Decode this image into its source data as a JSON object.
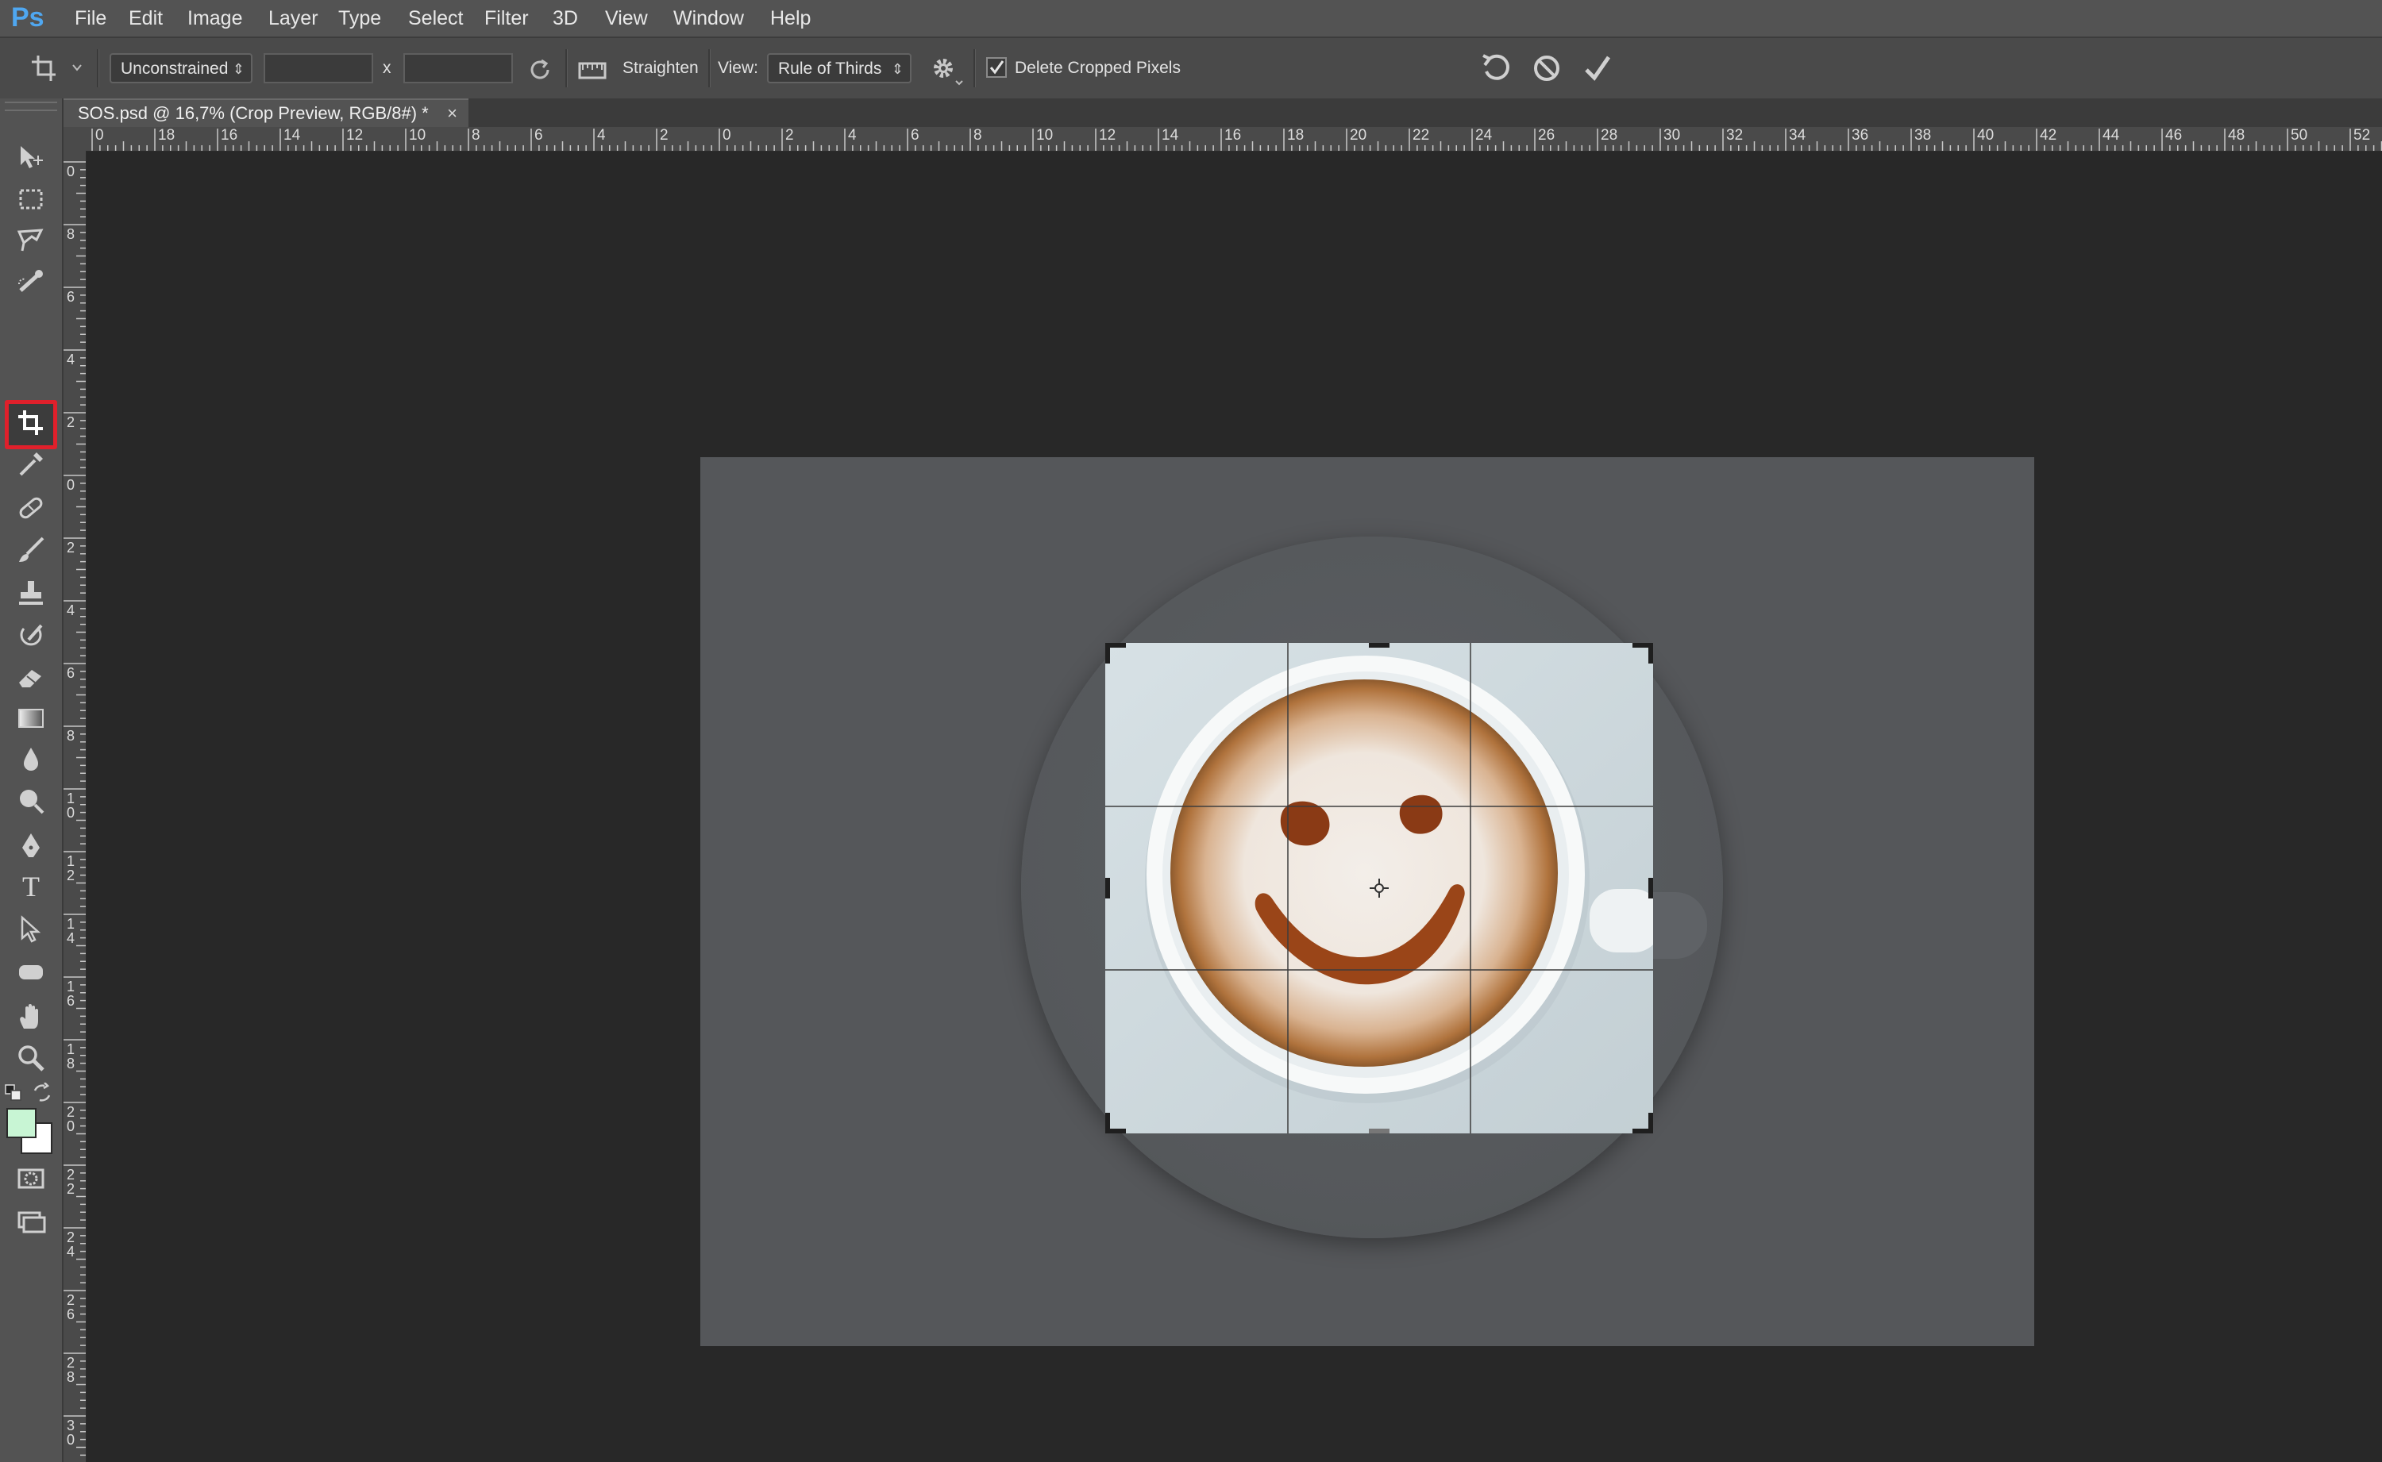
{
  "app": {
    "logo": "Ps"
  },
  "menu": [
    "File",
    "Edit",
    "Image",
    "Layer",
    "Type",
    "Select",
    "Filter",
    "3D",
    "View",
    "Window",
    "Help"
  ],
  "options": {
    "ratio_preset": "Unconstrained",
    "width_value": "",
    "times_symbol": "x",
    "height_value": "",
    "straighten_label": "Straighten",
    "view_label": "View:",
    "view_value": "Rule of Thirds",
    "delete_cropped_label": "Delete Cropped Pixels",
    "delete_cropped_checked": true
  },
  "document": {
    "tab_title": "SOS.psd @ 16,7% (Crop Preview, RGB/8#) *",
    "close_symbol": "×"
  },
  "ruler_top_labels": [
    "0",
    "18",
    "16",
    "14",
    "12",
    "10",
    "8",
    "6",
    "4",
    "2",
    "0",
    "2",
    "4",
    "6",
    "8",
    "10",
    "12",
    "14",
    "16",
    "18",
    "20",
    "22",
    "24",
    "26",
    "28",
    "30",
    "32",
    "34",
    "36",
    "38",
    "40",
    "42",
    "44",
    "46",
    "48",
    "50",
    "52"
  ],
  "ruler_left_labels": [
    "0",
    "8",
    "6",
    "4",
    "2",
    "0",
    "2",
    "4",
    "6",
    "8",
    "10",
    "12",
    "14",
    "16",
    "18",
    "20",
    "22",
    "24",
    "26",
    "28",
    "30"
  ],
  "tools": [
    "move-tool",
    "marquee-tool",
    "lasso-tool",
    "quick-selection-tool",
    "crop-tool",
    "eyedropper-tool",
    "healing-brush-tool",
    "brush-tool",
    "clone-stamp-tool",
    "history-brush-tool",
    "eraser-tool",
    "gradient-tool",
    "blur-tool",
    "dodge-tool",
    "pen-tool",
    "type-tool",
    "path-selection-tool",
    "shape-tool",
    "hand-tool",
    "zoom-tool"
  ],
  "active_tool": "crop-tool",
  "type_tool_glyph": "T",
  "colors": {
    "foreground": "#c8f5d4",
    "background": "#ffffff",
    "highlight": "#e0202b"
  }
}
